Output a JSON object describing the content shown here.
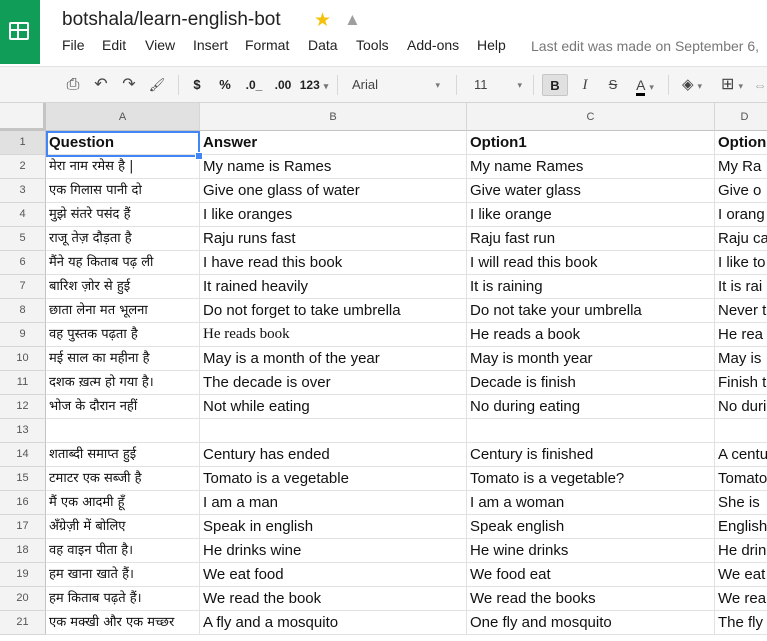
{
  "doc": {
    "title": "botshala/learn-english-bot",
    "last_edit": "Last edit was made on September 6,"
  },
  "menu": [
    "File",
    "Edit",
    "View",
    "Insert",
    "Format",
    "Data",
    "Tools",
    "Add-ons",
    "Help"
  ],
  "toolbar": {
    "print_icon": "⎙",
    "undo_icon": "↶",
    "redo_icon": "↷",
    "paint_icon": "🖌",
    "currency": "$",
    "percent": "%",
    "dec_less": ".0_",
    "dec_more": ".00",
    "format_more": "123",
    "font": "Arial",
    "font_size": "11",
    "bold": "B",
    "text_color": "A",
    "dropdown": "▾",
    "fill_icon": "◈",
    "borders_icon": "⊞",
    "merge_icon": "⇔"
  },
  "grid": {
    "columns": [
      "A",
      "B",
      "C",
      "D"
    ],
    "rows": [
      {
        "n": "1",
        "q": "Question",
        "a": "Answer",
        "o1": "Option1",
        "o2": "Option"
      },
      {
        "n": "2",
        "q": "मेरा नाम रमेस है |",
        "a": "My name is Rames",
        "o1": "My name Rames",
        "o2": "My Ra"
      },
      {
        "n": "3",
        "q": "एक गिलास पानी दो",
        "a": "Give one glass of water",
        "o1": "Give water glass",
        "o2": "Give o"
      },
      {
        "n": "4",
        "q": "मुझे संतरे पसंद हैं",
        "a": "I like oranges",
        "o1": "I like orange",
        "o2": "I orang"
      },
      {
        "n": "5",
        "q": "राजू तेज़ दौड़ता है",
        "a": "Raju runs fast",
        "o1": "Raju fast run",
        "o2": "Raju ca"
      },
      {
        "n": "6",
        "q": "मैंने यह किताब पढ़ ली",
        "a": "I have read this book",
        "o1": "I will read this book",
        "o2": "I like to"
      },
      {
        "n": "7",
        "q": "बारिश ज़ोर से हुई",
        "a": "It rained heavily",
        "o1": "It is raining",
        "o2": "It is rai"
      },
      {
        "n": "8",
        "q": "छाता लेना मत भूलना",
        "a": "Do not forget to take umbrella",
        "o1": "Do not take your umbrella",
        "o2": "Never t"
      },
      {
        "n": "9",
        "q": "वह पुस्तक पढ़ता है",
        "a": "He reads book",
        "o1": "He reads a book",
        "o2": "He rea"
      },
      {
        "n": "10",
        "q": "मई  साल का महीना है",
        "a": "May is a month of the year",
        "o1": "May is month year",
        "o2": "May is"
      },
      {
        "n": "11",
        "q": "दशक ख़त्म हो गया है।",
        "a": "The decade is over",
        "o1": "Decade is finish",
        "o2": "Finish t"
      },
      {
        "n": "12",
        "q": "भोज के दौरान नहीं",
        "a": "Not while eating",
        "o1": "No during eating",
        "o2": "No duri"
      },
      {
        "n": "13",
        "q": "",
        "a": "",
        "o1": "",
        "o2": ""
      },
      {
        "n": "14",
        "q": "शताब्दी समाप्त हुई",
        "a": "Century has ended",
        "o1": "Century is finished",
        "o2": "A centu"
      },
      {
        "n": "15",
        "q": "टमाटर एक सब्जी है",
        "a": "Tomato is a vegetable",
        "o1": "Tomato is a vegetable?",
        "o2": "Tomato"
      },
      {
        "n": "16",
        "q": "मैं एक आदमी हूँ",
        "a": "I am a man",
        "o1": "I am a woman",
        "o2": "She is"
      },
      {
        "n": "17",
        "q": "अँग्रेज़ी में बोलिए",
        "a": "Speak in english",
        "o1": "Speak english",
        "o2": "English"
      },
      {
        "n": "18",
        "q": "वह वाइन पीता है।",
        "a": "He drinks wine",
        "o1": "He wine drinks",
        "o2": "He drin"
      },
      {
        "n": "19",
        "q": "हम खाना खाते हैं।",
        "a": "We eat food",
        "o1": "We food eat",
        "o2": "We eat"
      },
      {
        "n": "20",
        "q": "हम किताब पढ़ते हैं।",
        "a": "We read the book",
        "o1": "We read the books",
        "o2": "We rea"
      },
      {
        "n": "21",
        "q": "एक मक्खी और एक मच्छर",
        "a": "A fly and a mosquito",
        "o1": "One fly and mosquito",
        "o2": "The fly"
      }
    ]
  }
}
